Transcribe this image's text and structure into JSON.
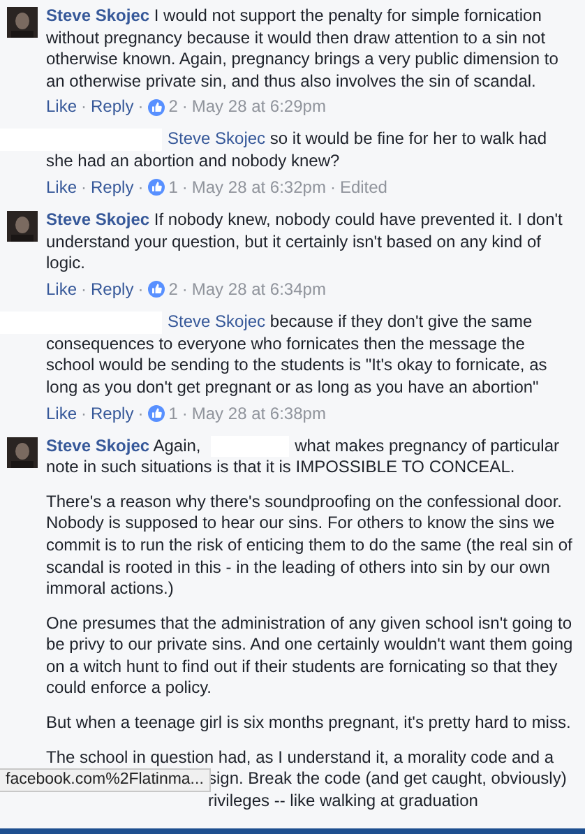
{
  "comments": [
    {
      "kind": "comment",
      "author": "Steve Skojec",
      "paragraphs": [
        [
          {
            "kind": "text",
            "text": "I would not support the penalty for simple fornication without pregnancy because it would then draw attention to a sin not otherwise known. Again, pregnancy brings a very public dimension to an otherwise private sin, and thus also involves the sin of scandal."
          }
        ]
      ],
      "meta": [
        {
          "kind": "action",
          "text": "Like"
        },
        {
          "kind": "sep",
          "text": "·"
        },
        {
          "kind": "action",
          "text": "Reply"
        },
        {
          "kind": "sep",
          "text": "·"
        },
        {
          "kind": "likes",
          "text": "2"
        },
        {
          "kind": "sep",
          "text": "·"
        },
        {
          "kind": "time",
          "text": "May 28 at 6:29pm"
        }
      ]
    },
    {
      "kind": "reply",
      "mention": "Steve Skojec",
      "paragraphs": [
        [
          {
            "kind": "text",
            "text": "so it would be fine for her to walk had she had an abortion and nobody knew?"
          }
        ]
      ],
      "meta": [
        {
          "kind": "action",
          "text": "Like"
        },
        {
          "kind": "sep",
          "text": "·"
        },
        {
          "kind": "action",
          "text": "Reply"
        },
        {
          "kind": "sep",
          "text": "·"
        },
        {
          "kind": "likes",
          "text": "1"
        },
        {
          "kind": "sep",
          "text": "·"
        },
        {
          "kind": "time",
          "text": "May 28 at 6:32pm"
        },
        {
          "kind": "sep",
          "text": "·"
        },
        {
          "kind": "edited",
          "text": "Edited"
        }
      ]
    },
    {
      "kind": "comment",
      "author": "Steve Skojec",
      "paragraphs": [
        [
          {
            "kind": "text",
            "text": "If nobody knew, nobody could have prevented it. I don't understand your question, but it certainly isn't based on any kind of logic."
          }
        ]
      ],
      "meta": [
        {
          "kind": "action",
          "text": "Like"
        },
        {
          "kind": "sep",
          "text": "·"
        },
        {
          "kind": "action",
          "text": "Reply"
        },
        {
          "kind": "sep",
          "text": "·"
        },
        {
          "kind": "likes",
          "text": "2"
        },
        {
          "kind": "sep",
          "text": "·"
        },
        {
          "kind": "time",
          "text": "May 28 at 6:34pm"
        }
      ]
    },
    {
      "kind": "reply",
      "mention": "Steve Skojec",
      "paragraphs": [
        [
          {
            "kind": "text",
            "text": "because if they don't give the same consequences to everyone who fornicates then the message the school would be sending to the students is \"It's okay to fornicate, as long as you don't get pregnant or as long as you have an abortion\""
          }
        ]
      ],
      "meta": [
        {
          "kind": "action",
          "text": "Like"
        },
        {
          "kind": "sep",
          "text": "·"
        },
        {
          "kind": "action",
          "text": "Reply"
        },
        {
          "kind": "sep",
          "text": "·"
        },
        {
          "kind": "likes",
          "text": "1"
        },
        {
          "kind": "sep",
          "text": "·"
        },
        {
          "kind": "time",
          "text": "May 28 at 6:38pm"
        }
      ]
    },
    {
      "kind": "comment",
      "author": "Steve Skojec",
      "paragraphs": [
        [
          {
            "kind": "text",
            "text": "Again,"
          },
          {
            "kind": "redacted"
          },
          {
            "kind": "text",
            "text": "what makes pregnancy of particular note in such situations is that it is IMPOSSIBLE TO CONCEAL."
          }
        ],
        [
          {
            "kind": "text",
            "text": "There's a reason why there's soundproofing on the confessional door. Nobody is supposed to hear our sins. For others to know the sins we commit is to run the risk of enticing them to do the same (the real sin of scandal is rooted in this - in the leading of others into sin by our own immoral actions.)"
          }
        ],
        [
          {
            "kind": "text",
            "text": "One presumes that the administration of any given school isn't going to be privy to our private sins. And one certainly wouldn't want them going on a witch hunt to find out if their students are fornicating so that they could enforce a policy."
          }
        ],
        [
          {
            "kind": "text",
            "text": "But when a teenage girl is six months pregnant, it's pretty hard to miss."
          }
        ],
        [
          {
            "kind": "text",
            "text": "The school in question had, as I understand it, a morality code and a"
          },
          {
            "kind": "covered_line",
            "text": "sign. Break the code (and get caught, obviously)"
          },
          {
            "kind": "covered_line",
            "text": "rivileges -- like walking at graduation"
          }
        ]
      ]
    }
  ],
  "status_link": "facebook.com%2Flatinma..."
}
